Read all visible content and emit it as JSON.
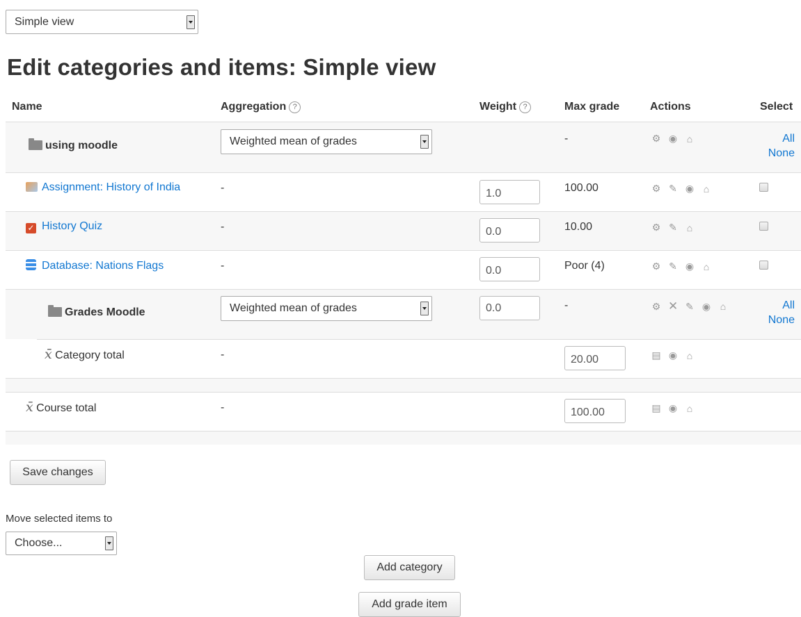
{
  "view_selector": {
    "value": "Simple view"
  },
  "page_title": "Edit categories and items: Simple view",
  "table": {
    "headers": {
      "name": "Name",
      "aggregation": "Aggregation",
      "weight": "Weight",
      "max_grade": "Max grade",
      "actions": "Actions",
      "select": "Select"
    },
    "help_glyph": "?",
    "rows": [
      {
        "type": "category",
        "name": "using moodle",
        "aggregation": "Weighted mean of grades",
        "max_grade": "-",
        "select_all": "All",
        "select_none": "None",
        "actions": [
          "gear-icon",
          "eye-icon",
          "lock-icon"
        ]
      },
      {
        "type": "item",
        "icon": "assignment-icon",
        "name": "Assignment: History of India",
        "aggregation": "-",
        "weight": "1.0",
        "max_grade": "100.00",
        "actions": [
          "gear-icon",
          "edit-icon",
          "eye-icon",
          "lock-icon"
        ]
      },
      {
        "type": "item",
        "icon": "quiz-icon",
        "name": "History Quiz",
        "aggregation": "-",
        "weight": "0.0",
        "max_grade": "10.00",
        "actions": [
          "gear-icon",
          "edit-icon",
          "lock-icon"
        ]
      },
      {
        "type": "item",
        "icon": "database-icon",
        "name": "Database: Nations Flags",
        "aggregation": "-",
        "weight": "0.0",
        "max_grade": "Poor (4)",
        "actions": [
          "gear-icon",
          "edit-icon",
          "eye-icon",
          "lock-icon"
        ]
      },
      {
        "type": "subcategory",
        "name": "Grades Moodle",
        "aggregation": "Weighted mean of grades",
        "weight": "0.0",
        "max_grade": "-",
        "select_all": "All",
        "select_none": "None",
        "actions": [
          "gear-icon",
          "delete-icon",
          "edit-icon",
          "eye-icon",
          "lock-icon"
        ]
      },
      {
        "type": "total",
        "name": "Category total",
        "aggregation": "-",
        "max_grade": "20.00",
        "actions": [
          "calculator-icon",
          "eye-icon",
          "lock-icon"
        ]
      },
      {
        "type": "total",
        "name": "Course total",
        "aggregation": "-",
        "max_grade": "100.00",
        "actions": [
          "calculator-icon",
          "eye-icon",
          "lock-icon"
        ]
      }
    ]
  },
  "save_button": "Save changes",
  "move": {
    "label": "Move selected items to",
    "value": "Choose..."
  },
  "add_category_button": "Add category",
  "add_grade_item_button": "Add grade item",
  "colors": {
    "link": "#1177d1",
    "row_shade": "#f7f7f7",
    "border": "#dddddd",
    "text": "#333333"
  }
}
